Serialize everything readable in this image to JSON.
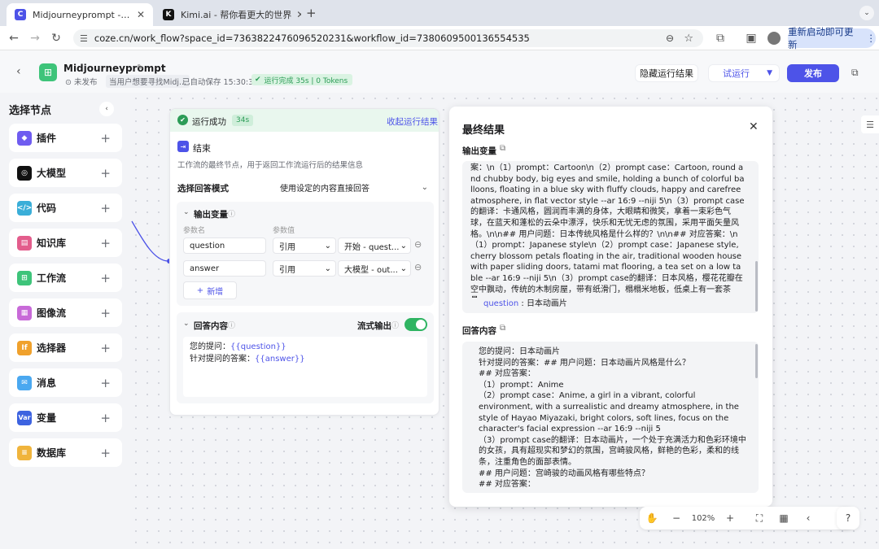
{
  "browser": {
    "tabs": [
      {
        "title": "Midjourneyprompt - 工作流 -",
        "active": true,
        "icon": "coze-icon"
      },
      {
        "title": "Kimi.ai - 帮你看更大的世界",
        "active": false,
        "icon": "kimi-icon"
      }
    ],
    "url": "coze.cn/work_flow?space_id=7363822476096520231&workflow_id=7380609500136554535",
    "restart_label": "重新启动即可更新"
  },
  "header": {
    "title": "Midjourneyprompt",
    "status": "未发布",
    "description": "当用户想要寻找Midj...",
    "autosave": "已自动保存 15:30:31",
    "run_status": "运行完成 35s | 0 Tokens",
    "hide_results_label": "隐藏运行结果",
    "test_run_label": "试运行",
    "publish_label": "发布"
  },
  "sidebar": {
    "title": "选择节点",
    "items": [
      {
        "label": "插件",
        "color": "#6f5cf0",
        "icon": "plugin-icon"
      },
      {
        "label": "大模型",
        "color": "#111111",
        "icon": "llm-icon"
      },
      {
        "label": "代码",
        "color": "#3aaed8",
        "icon": "code-icon"
      },
      {
        "label": "知识库",
        "color": "#e35d8c",
        "icon": "knowledge-icon"
      },
      {
        "label": "工作流",
        "color": "#3ec47a",
        "icon": "workflow-icon"
      },
      {
        "label": "图像流",
        "color": "#c86ad8",
        "icon": "imageflow-icon"
      },
      {
        "label": "选择器",
        "color": "#f0a12c",
        "icon": "selector-icon"
      },
      {
        "label": "消息",
        "color": "#4aa8f0",
        "icon": "message-icon"
      },
      {
        "label": "变量",
        "color": "#3d63e0",
        "icon": "variable-icon"
      },
      {
        "label": "数据库",
        "color": "#f0b43c",
        "icon": "database-icon"
      }
    ]
  },
  "node": {
    "run_success": "运行成功",
    "time": "34s",
    "collapse_label": "收起运行结果",
    "name": "结束",
    "description": "工作流的最终节点，用于返回工作流运行后的结果信息",
    "reply_mode_label": "选择回答模式",
    "reply_mode_value": "使用设定的内容直接回答",
    "output_vars_label": "输出变量",
    "col_param_name": "参数名",
    "col_param_value": "参数值",
    "vars": [
      {
        "name": "question",
        "type": "引用",
        "ref": "开始 - quest..."
      },
      {
        "name": "answer",
        "type": "引用",
        "ref": "大模型 - out..."
      }
    ],
    "add_label": "新增",
    "reply_content_label": "回答内容",
    "stream_output_label": "流式输出",
    "template_line1_prefix": "您的提问：",
    "template_line1_var": "{{question}}",
    "template_line2_prefix": "针对提问的答案：",
    "template_line2_var": "{{answer}}"
  },
  "result": {
    "title": "最终结果",
    "output_var_label": "输出变量",
    "output_text": "案：\\n（1）prompt：Cartoon\\n（2）prompt case：Cartoon, round and chubby body, big eyes and smile, holding a bunch of colorful balloons, floating in a blue sky with fluffy clouds, happy and carefree atmosphere, in flat vector style --ar 16:9 --niji 5\\n（3）prompt case的翻译：卡通风格，圆润而丰满的身体，大眼睛和微笑，拿着一束彩色气球，在蓝天和蓬松的云朵中漂浮，快乐和无忧无虑的氛围，采用平面矢量风格。\\n\\n## 用户问题：日本传统风格是什么样的？\\n\\n## 对应答案：\\n（1）prompt：Japanese style\\n（2）prompt case：Japanese style, cherry blossom petals floating in the air, traditional wooden house with paper sliding doors, tatami mat flooring, a tea set on a low table --ar 16:9 --niji 5\\n（3）prompt case的翻译：日本风格，樱花花瓣在空中飘动，传统的木制房屋，带有纸滑门，榻榻米地板，低桌上有一套茶具。",
    "question_key": "question",
    "question_value": "日本动画片",
    "reply_label": "回答内容",
    "reply_lines": [
      "您的提问：日本动画片",
      "针对提问的答案：## 用户问题：日本动画片风格是什么？",
      "## 对应答案：",
      "（1）prompt：Anime",
      "（2）prompt case：Anime, a girl in a vibrant, colorful environment, with a surrealistic and dreamy atmosphere, in the style of Hayao Miyazaki, bright colors, soft lines, focus on the character's facial expression --ar 16:9 --niji 5",
      "（3）prompt case的翻译：日本动画片，一个处于充满活力和色彩环境中的女孩，具有超现实和梦幻的氛围，宫崎骏风格，鲜艳的色彩，柔和的线条，注重角色的面部表情。",
      "## 用户问题：宫崎骏的动画风格有哪些特点？",
      "## 对应答案："
    ]
  },
  "toolbar": {
    "zoom": "102%"
  },
  "colors": {
    "accent": "#4d53e8",
    "success": "#2c9c57",
    "link": "#4d53e8"
  }
}
